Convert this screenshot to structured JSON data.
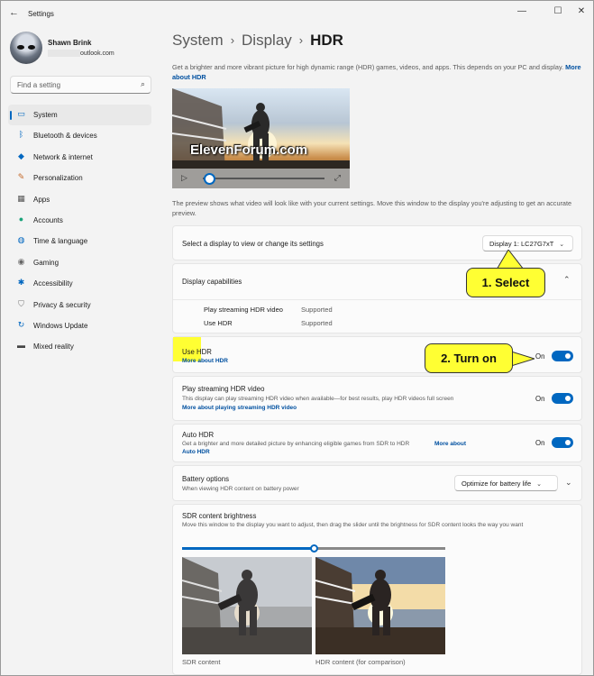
{
  "window": {
    "title": "Settings",
    "back_icon": "back-arrow-icon"
  },
  "user": {
    "name": "Shawn Brink",
    "email_suffix": "outlook.com"
  },
  "search": {
    "placeholder": "Find a setting"
  },
  "nav": {
    "items": [
      {
        "label": "System",
        "icon": "system-icon",
        "active": true
      },
      {
        "label": "Bluetooth & devices",
        "icon": "bluetooth-icon"
      },
      {
        "label": "Network & internet",
        "icon": "wifi-icon"
      },
      {
        "label": "Personalization",
        "icon": "brush-icon"
      },
      {
        "label": "Apps",
        "icon": "apps-icon"
      },
      {
        "label": "Accounts",
        "icon": "person-icon"
      },
      {
        "label": "Time & language",
        "icon": "globe-clock-icon"
      },
      {
        "label": "Gaming",
        "icon": "gamepad-icon"
      },
      {
        "label": "Accessibility",
        "icon": "accessibility-icon"
      },
      {
        "label": "Privacy & security",
        "icon": "shield-icon"
      },
      {
        "label": "Windows Update",
        "icon": "update-icon"
      },
      {
        "label": "Mixed reality",
        "icon": "headset-icon"
      }
    ]
  },
  "breadcrumb": {
    "level1": "System",
    "level2": "Display",
    "current": "HDR",
    "separator": "›"
  },
  "intro": {
    "text": "Get a brighter and more vibrant picture for high dynamic range (HDR) games, videos, and apps. This depends on your PC and display.",
    "link": "More about HDR"
  },
  "video": {
    "watermark": "ElevenForum.com"
  },
  "preview_note": "The preview shows what video will look like with your current settings. Move this window to the display you're adjusting to get an accurate preview.",
  "display_select": {
    "label": "Select a display to view or change its settings",
    "value": "Display 1: LC27G7xT"
  },
  "capabilities": {
    "title": "Display capabilities",
    "rows": [
      {
        "name": "Play streaming HDR video",
        "status": "Supported"
      },
      {
        "name": "Use HDR",
        "status": "Supported"
      }
    ]
  },
  "use_hdr": {
    "title": "Use HDR",
    "link": "More about HDR",
    "state": "On"
  },
  "streaming": {
    "title": "Play streaming HDR video",
    "desc": "This display can play streaming HDR video when available—for best results, play HDR videos full screen",
    "link": "More about playing streaming HDR video",
    "state": "On"
  },
  "auto_hdr": {
    "title": "Auto HDR",
    "desc": "Get a brighter and more detailed picture by enhancing eligible games from SDR to HDR",
    "link_a": "More about",
    "link_b": "Auto HDR",
    "state": "On"
  },
  "battery": {
    "title": "Battery options",
    "desc": "When viewing HDR content on battery power",
    "value": "Optimize for battery life"
  },
  "sdr": {
    "title": "SDR content brightness",
    "desc": "Move this window to the display you want to adjust, then drag the slider until the brightness for SDR content looks the way you want",
    "level": 0.5,
    "caption_left": "SDR content",
    "caption_right": "HDR content (for comparison)"
  },
  "callouts": {
    "select": "1. Select",
    "turn_on": "2. Turn on"
  },
  "colors": {
    "accent": "#0067c0",
    "callout": "#ffff33"
  }
}
